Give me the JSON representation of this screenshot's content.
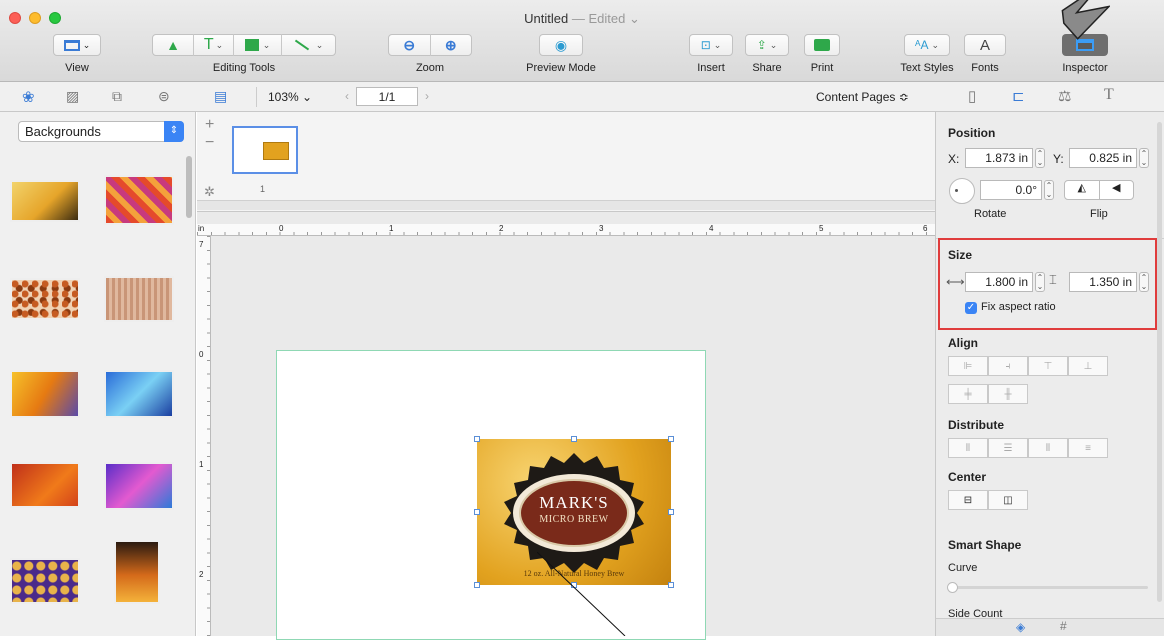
{
  "window": {
    "title": "Untitled",
    "title_suffix": "— Edited ⌄"
  },
  "toolbar": {
    "view_label": "View",
    "editing_tools_label": "Editing Tools",
    "zoom_label": "Zoom",
    "preview_label": "Preview Mode",
    "insert_label": "Insert",
    "share_label": "Share",
    "print_label": "Print",
    "text_styles_label": "Text Styles",
    "fonts_label": "Fonts",
    "inspector_label": "Inspector",
    "fonts_glyph": "A",
    "text_tool_glyph": "T"
  },
  "secondary_bar": {
    "zoom_value": "103% ⌄",
    "page_value": "1/1",
    "content_pages": "Content Pages ≎"
  },
  "left_panel": {
    "dropdown_value": "Backgrounds"
  },
  "thumbnails": {
    "page_number": "1"
  },
  "ruler": {
    "unit": "in",
    "top_ticks": [
      "0",
      "1",
      "2",
      "3",
      "4",
      "5",
      "6"
    ],
    "left_ticks": [
      "7",
      "0",
      "1",
      "2"
    ]
  },
  "label": {
    "brand": "MARK'S",
    "subtitle": "MICRO BREW",
    "tagline": "12 oz. All-Natural Honey Brew"
  },
  "inspector": {
    "position_title": "Position",
    "x_label": "X:",
    "x_value": "1.873 in",
    "y_label": "Y:",
    "y_value": "0.825 in",
    "rotate_value": "0.0°",
    "rotate_label": "Rotate",
    "flip_label": "Flip",
    "size_title": "Size",
    "width_value": "1.800 in",
    "height_value": "1.350 in",
    "aspect_label": "Fix aspect ratio",
    "aspect_checked": true,
    "align_title": "Align",
    "distribute_title": "Distribute",
    "center_title": "Center",
    "smart_shape_title": "Smart Shape",
    "curve_label": "Curve",
    "side_count_label": "Side Count"
  },
  "colors": {
    "highlight": "#e03c3c",
    "accent": "#3b82f6",
    "label_gold": "#e2a21f",
    "oval": "#7a2a1a"
  }
}
